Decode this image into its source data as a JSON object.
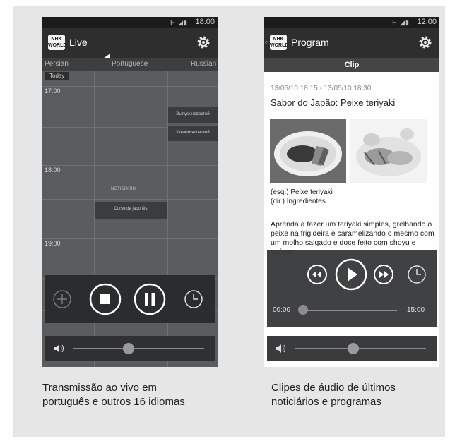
{
  "left_screen": {
    "status_time": "18:00",
    "status_icons": "H",
    "app_title": "Live",
    "logo_text": [
      "NHK",
      "WORLD"
    ],
    "languages": [
      "Persian",
      "Portuguese",
      "Russian"
    ],
    "today_label": "Today",
    "hours": [
      "17:00",
      "18:00",
      "19:00"
    ],
    "grid_program_1": "Выпуск новостей",
    "grid_program_2": "Узнаем японский",
    "grid_program_3_heading": "NOTICIÁRIO",
    "grid_program_3": "Curso de japonês",
    "caption": [
      "Transmissão ao vivo em",
      "português e outros 16 idiomas"
    ]
  },
  "right_screen": {
    "status_time": "12:00",
    "status_icons": "H",
    "app_title": "Program",
    "logo_text": [
      "NHK",
      "WORLD"
    ],
    "section_header": "Clip",
    "date_range": "13/05/10 18:15 - 13/05/10 18:30",
    "program_title": "Sabor do Japão: Peixe teriyaki",
    "image_caption": [
      "(esq.) Peixe teriyaki",
      "(dir.) Ingredientes"
    ],
    "description": "Aprenda a fazer um teriyaki simples, grelhando o peixe na frigideira e caramelizando o mesmo com um molho salgado e doce feito com shoyu e açúcar.",
    "time_start": "00:00",
    "time_end": "15:00",
    "caption": [
      "Clipes de áudio de últimos",
      "noticiários e programas"
    ]
  },
  "colors": {
    "page_bg": "#e6e6e6",
    "action_bar": "#2e2e2e",
    "status_bar": "#1b1b1b",
    "control_panel": "#2b2c2e",
    "accent_white": "#ffffff"
  },
  "icons": [
    "gear-icon",
    "add-icon",
    "stop-icon",
    "pause-icon",
    "clock-icon",
    "rewind-icon",
    "play-icon",
    "fast-forward-icon",
    "volume-icon"
  ]
}
